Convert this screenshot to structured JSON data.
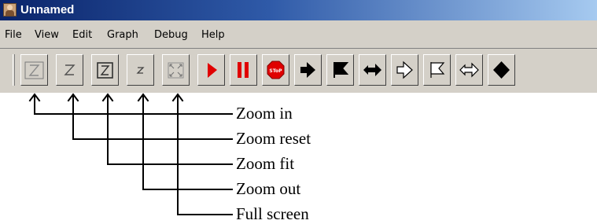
{
  "window": {
    "title": "Unnamed",
    "icon": "app-person-icon"
  },
  "menu": {
    "items": [
      "File",
      "View",
      "Edit",
      "Graph",
      "Debug",
      "Help"
    ]
  },
  "toolbar": {
    "buttons": [
      {
        "name": "zoom-in",
        "icon": "zoom-in-icon"
      },
      {
        "name": "zoom-reset",
        "icon": "zoom-reset-icon"
      },
      {
        "name": "zoom-fit",
        "icon": "zoom-fit-icon"
      },
      {
        "name": "zoom-out",
        "icon": "zoom-out-icon"
      },
      {
        "name": "full-screen",
        "icon": "full-screen-icon"
      },
      {
        "name": "run",
        "icon": "play-icon"
      },
      {
        "name": "pause",
        "icon": "pause-icon"
      },
      {
        "name": "stop",
        "icon": "stop-sign-icon"
      },
      {
        "name": "step",
        "icon": "arrow-right-icon"
      },
      {
        "name": "flag",
        "icon": "flag-icon"
      },
      {
        "name": "step-over",
        "icon": "double-arrow-icon"
      },
      {
        "name": "step-outline",
        "icon": "arrow-outline-icon"
      },
      {
        "name": "flag-outline",
        "icon": "flag-outline-icon"
      },
      {
        "name": "double-arrow-outline",
        "icon": "double-arrow-outline-icon"
      },
      {
        "name": "diamond",
        "icon": "diamond-icon"
      }
    ],
    "stop_text": "SToP"
  },
  "annotations": {
    "labels": [
      "Zoom in",
      "Zoom reset",
      "Zoom fit",
      "Zoom out",
      "Full screen"
    ]
  },
  "colors": {
    "titlebar_start": "#0a246a",
    "titlebar_end": "#a6caf0",
    "face": "#d4d0c8",
    "accent_red": "#e00000"
  }
}
